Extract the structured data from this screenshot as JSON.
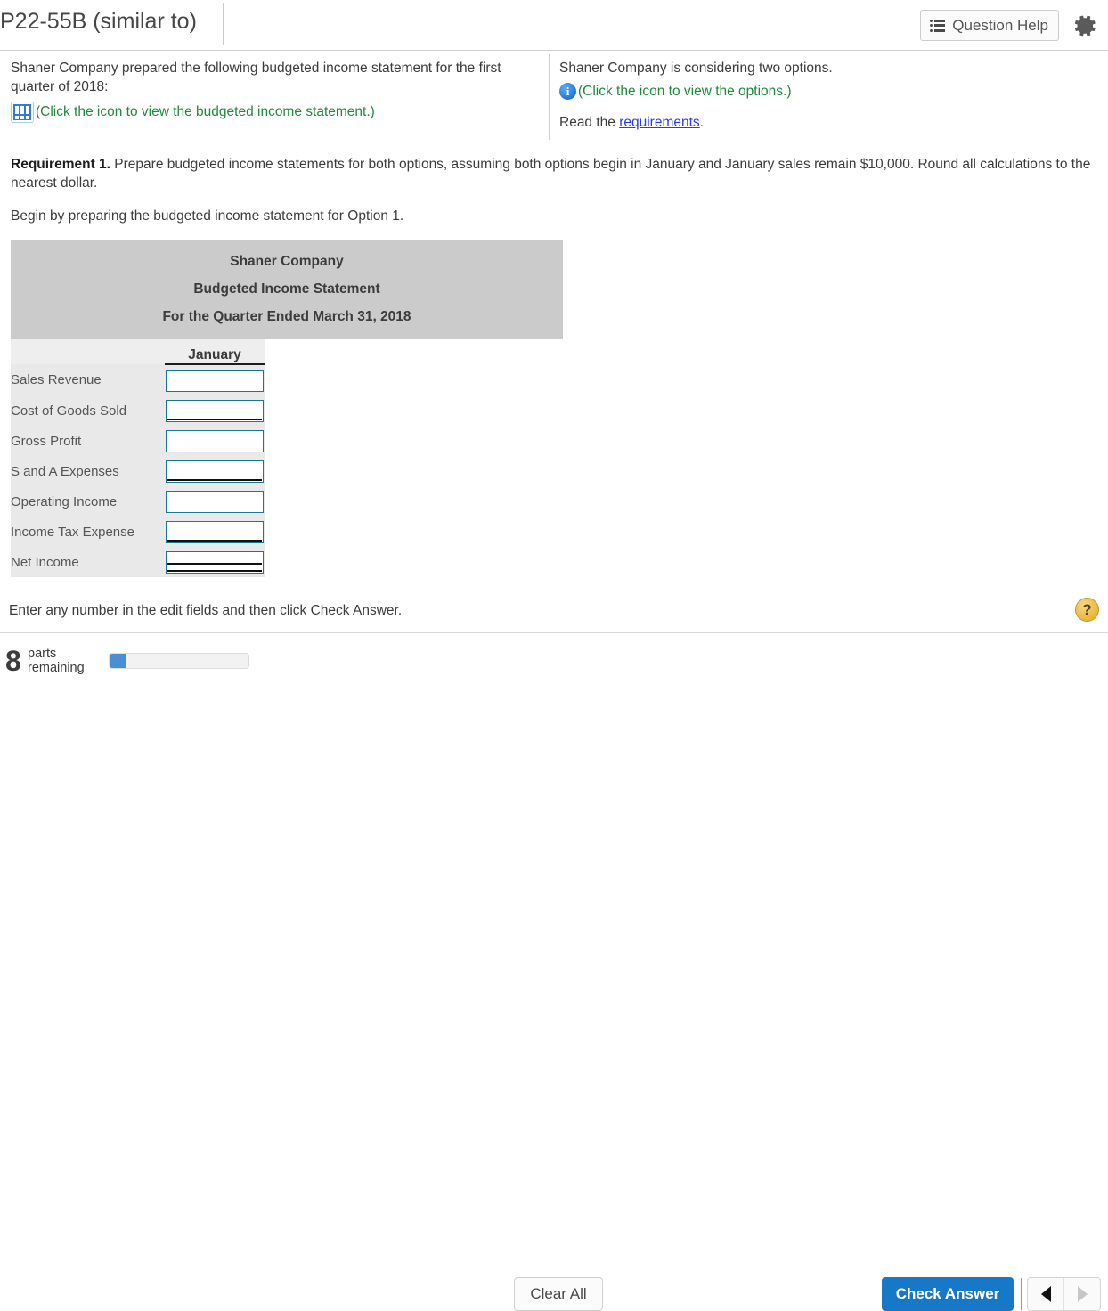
{
  "header": {
    "question_id": "P22-55B (similar to)",
    "question_help_label": "Question Help",
    "question_help_icon": "list-icon",
    "settings_icon": "gear-icon"
  },
  "problem": {
    "left": {
      "intro": "Shaner Company prepared the following budgeted income statement for the first quarter of 2018:",
      "icon": "table-grid-icon",
      "icon_link_text": "(Click the icon to view the budgeted income statement.)"
    },
    "right": {
      "intro": "Shaner Company is considering two options.",
      "icon": "info-icon",
      "icon_link_text": "(Click the icon to view the options.)",
      "read_prefix": "Read the ",
      "read_link": "requirements",
      "read_suffix": "."
    }
  },
  "requirement": {
    "label": "Requirement 1.",
    "body": " Prepare budgeted income statements for both options, assuming both options begin in January and January sales remain $10,000. Round all calculations to the nearest dollar.",
    "subtext": "Begin by preparing the budgeted income statement for Option 1."
  },
  "statement": {
    "title_line1": "Shaner Company",
    "title_line2": "Budgeted Income Statement",
    "title_line3": "For the Quarter Ended March 31, 2018",
    "column_header": "January",
    "rows": [
      {
        "label": "Sales Revenue",
        "value": "",
        "rule": "none"
      },
      {
        "label": "Cost of Goods Sold",
        "value": "",
        "rule": "single"
      },
      {
        "label": "Gross Profit",
        "value": "",
        "rule": "none"
      },
      {
        "label": "S and A Expenses",
        "value": "",
        "rule": "single"
      },
      {
        "label": "Operating Income",
        "value": "",
        "rule": "none"
      },
      {
        "label": "Income Tax Expense",
        "value": "",
        "rule": "single"
      },
      {
        "label": "Net Income",
        "value": "",
        "rule": "double"
      }
    ]
  },
  "hint": {
    "text": "Enter any number in the edit fields and then click Check Answer.",
    "help_badge": "?"
  },
  "footer": {
    "parts_count": "8",
    "parts_label_line1": "parts",
    "parts_label_line2": "remaining",
    "progress_percent": 12,
    "clear_all_label": "Clear All",
    "check_answer_label": "Check Answer",
    "prev_icon": "triangle-left-icon",
    "next_icon": "triangle-right-icon"
  },
  "colors": {
    "accent_blue": "#1878c8",
    "link_green": "#1f8a3b",
    "link_blue": "#2b3af0",
    "input_border": "#15798f",
    "header_gray": "#cbcbcb",
    "row_gray": "#e9e9e9",
    "help_gold": "#edbc4a"
  }
}
